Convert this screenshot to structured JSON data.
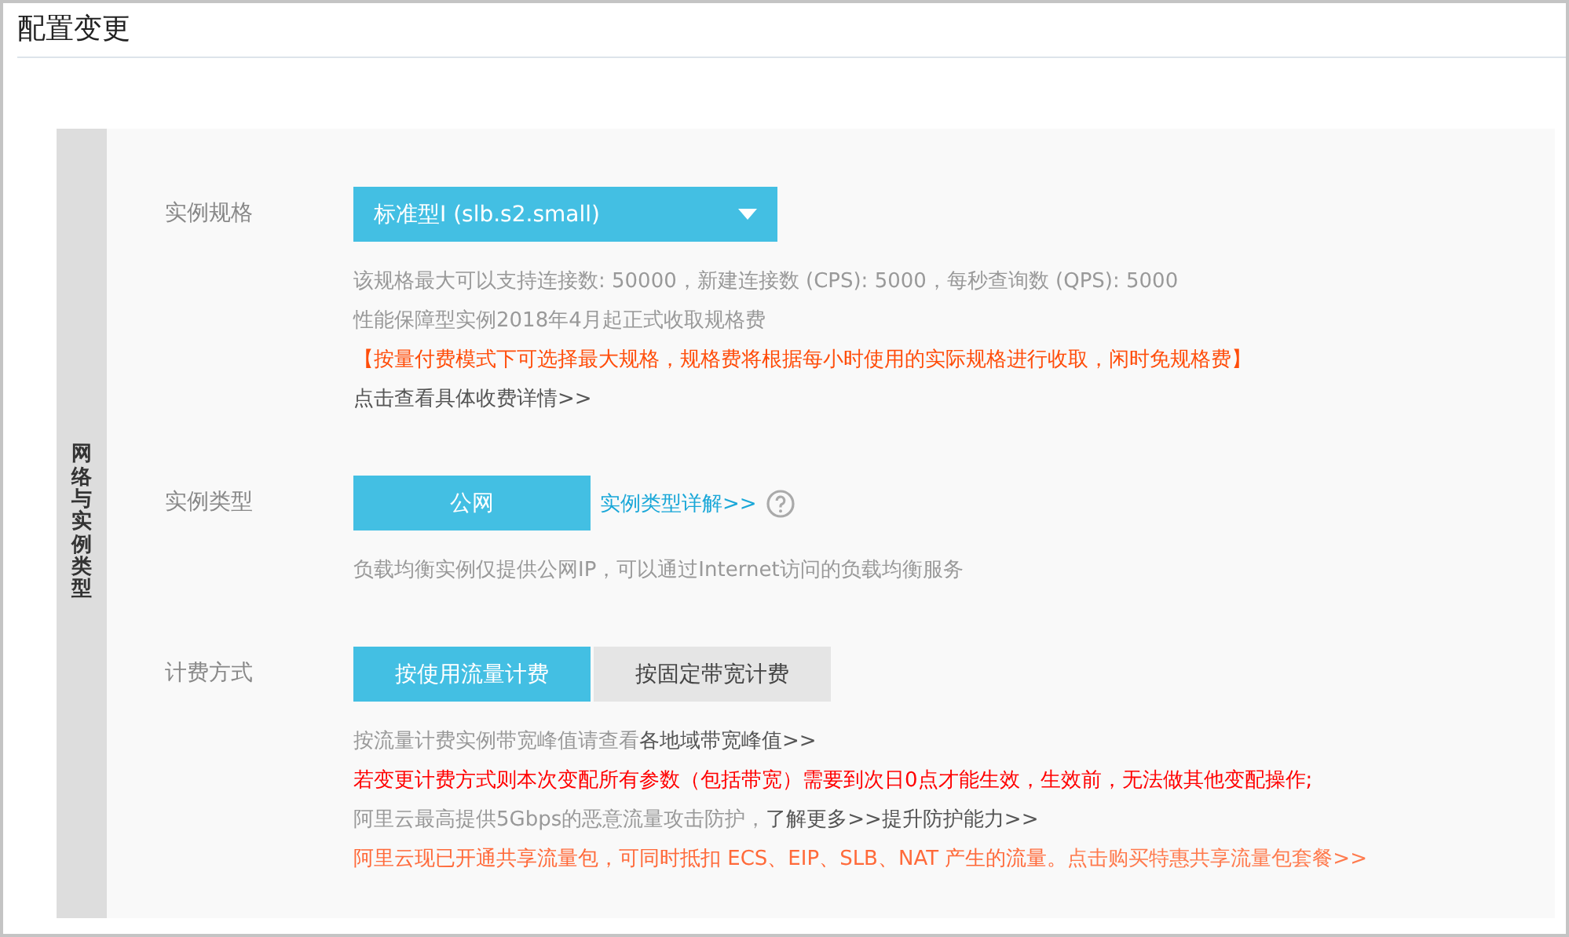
{
  "page": {
    "title": "配置变更"
  },
  "section": {
    "title": "网络与实例类型"
  },
  "rows": [
    {
      "kind": "dropdown",
      "label": "实例规格",
      "value": "标准型I (slb.s2.small)",
      "notes": [
        {
          "kind": "muted",
          "parts": [
            {
              "text": "该规格最大可以支持连接数: 50000，新建连接数 (CPS): 5000，每秒查询数 (QPS): 5000",
              "link": false
            }
          ]
        },
        {
          "kind": "muted",
          "parts": [
            {
              "text": "性能保障型实例2018年4月起正式收取规格费",
              "link": false
            }
          ]
        },
        {
          "kind": "warning",
          "parts": [
            {
              "text": "【按量付费模式下可选择最大规格，规格费将根据每小时使用的实际规格进行收取，闲时免规格费】",
              "link": false
            }
          ]
        },
        {
          "kind": "muted",
          "parts": [
            {
              "text": "点击查看具体收费详情>>",
              "link": true
            }
          ]
        }
      ]
    },
    {
      "kind": "options",
      "label": "实例类型",
      "options": [
        {
          "label": "公网",
          "selected": true
        }
      ],
      "help_link": "实例类型详解>>",
      "notes": [
        {
          "kind": "muted",
          "parts": [
            {
              "text": "负载均衡实例仅提供公网IP，可以通过Internet访问的负载均衡服务",
              "link": false
            }
          ]
        }
      ]
    },
    {
      "kind": "options",
      "label": "计费方式",
      "options": [
        {
          "label": "按使用流量计费",
          "selected": true
        },
        {
          "label": "按固定带宽计费",
          "selected": false
        }
      ],
      "notes": [
        {
          "kind": "muted",
          "parts": [
            {
              "text": "按流量计费实例带宽峰值请查看",
              "link": false
            },
            {
              "text": "各地域带宽峰值>>",
              "link": true
            }
          ]
        },
        {
          "kind": "error",
          "parts": [
            {
              "text": "若变更计费方式则本次变配所有参数（包括带宽）需要到次日0点才能生效，生效前，无法做其他变配操作;",
              "link": false
            }
          ]
        },
        {
          "kind": "muted",
          "parts": [
            {
              "text": "阿里云最高提供5Gbps的恶意流量攻击防护，",
              "link": false
            },
            {
              "text": "了解更多>>",
              "link": true
            },
            {
              "text": "提升防护能力>>",
              "link": true
            }
          ]
        },
        {
          "kind": "orange",
          "parts": [
            {
              "text": "阿里云现已开通共享流量包，可同时抵扣 ECS、EIP、SLB、NAT 产生的流量。",
              "link": false
            },
            {
              "text": "点击购买特惠共享流量包套餐>>",
              "link": true
            }
          ]
        }
      ]
    }
  ]
}
